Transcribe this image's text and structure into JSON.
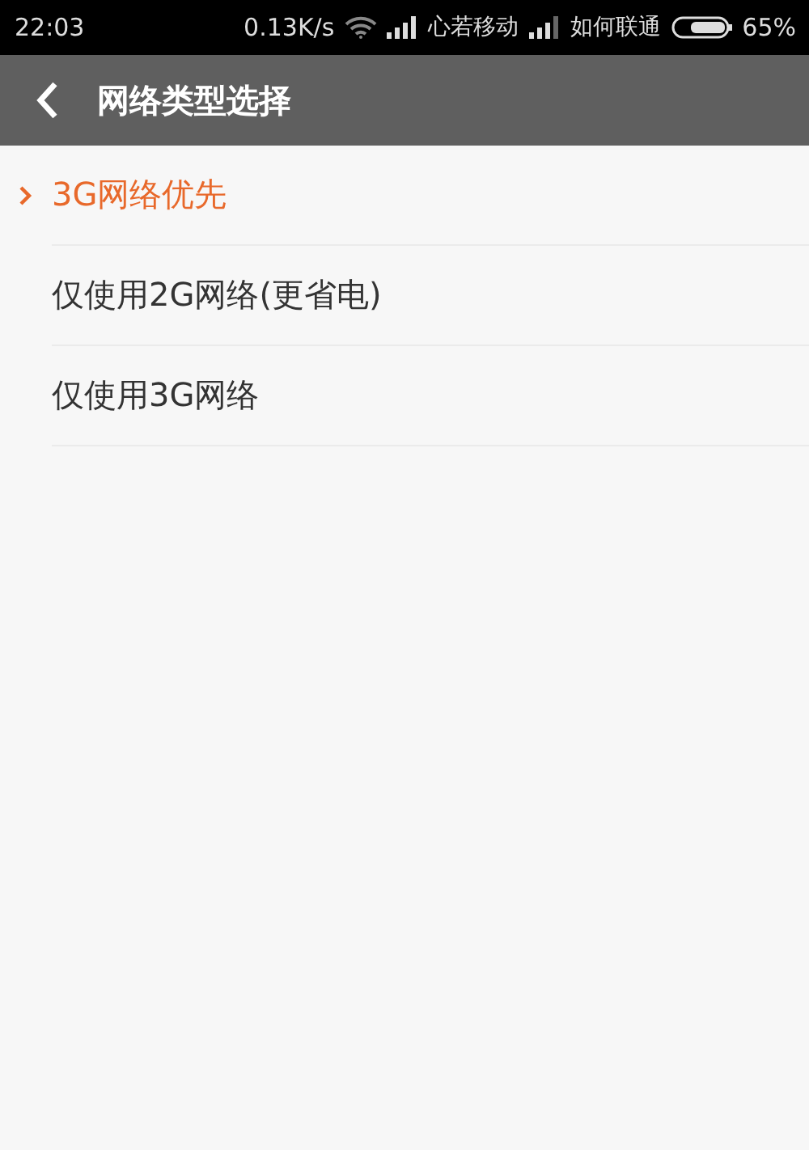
{
  "status_bar": {
    "time": "22:03",
    "speed": "0.13K/s",
    "carrier_1": "心若移动",
    "carrier_2": "如何联通",
    "battery": "65%"
  },
  "header": {
    "title": "网络类型选择"
  },
  "options": [
    {
      "label": "3G网络优先",
      "selected": true
    },
    {
      "label": "仅使用2G网络(更省电)",
      "selected": false
    },
    {
      "label": "仅使用3G网络",
      "selected": false
    }
  ]
}
